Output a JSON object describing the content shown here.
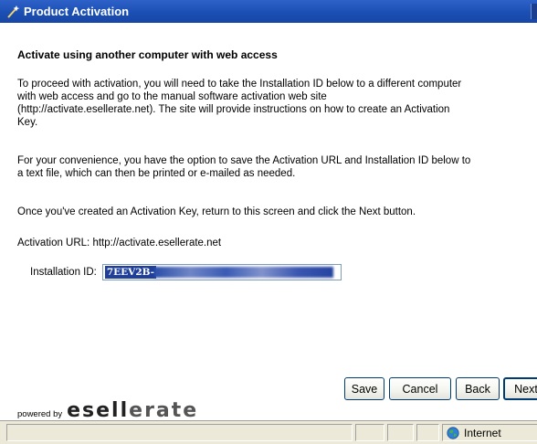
{
  "window": {
    "title": "Product Activation"
  },
  "heading": "Activate using another computer with web access",
  "paragraph1": [
    "To proceed with activation, you will need to take the Installation ID below to a different computer",
    "with web access and go to the manual software activation web site",
    "(http://activate.esellerate.net). The site will provide instructions on how to create an Activation",
    "Key."
  ],
  "paragraph2": [
    "For your convenience, you have the option to save the Activation URL and Installation ID below to",
    "a text file, which can then be printed or e-mailed as needed."
  ],
  "paragraph3": "Once you've created an Activation Key, return to this screen and click the Next button.",
  "activation_url": {
    "label": "Activation URL:",
    "value": "http://activate.esellerate.net"
  },
  "installation_id": {
    "label": "Installation ID:",
    "value": "7EEV2B-"
  },
  "powered_by": {
    "prefix": "powered by",
    "brand_main": "esell",
    "brand_tail": "erate"
  },
  "buttons": {
    "save": "Save",
    "cancel": "Cancel",
    "back": "Back",
    "next": "Next"
  },
  "statusbar": {
    "zone": "Internet"
  },
  "icons": {
    "title": "wand-icon",
    "zone": "globe-icon"
  },
  "colors": {
    "titlebar": "#2e62c9",
    "selection": "#1f3f9a",
    "button_border": "#003c74"
  }
}
